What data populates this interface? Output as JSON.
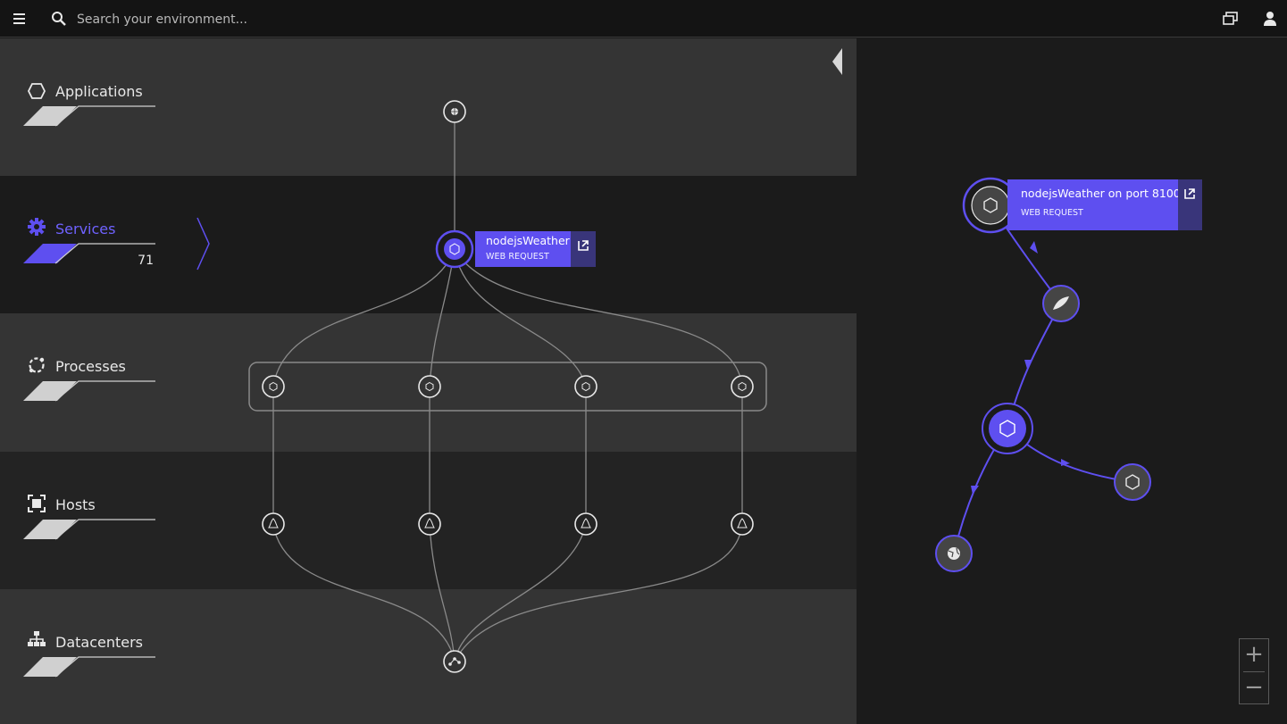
{
  "topbar": {
    "menu_icon": "hamburger-menu-icon",
    "search_icon": "magnifier-search-icon",
    "search_placeholder": "Search your environment...",
    "right_icons": [
      "chat-windows-icon",
      "user-icon"
    ]
  },
  "layers": [
    {
      "label": "Applications",
      "icon": "hexagon-outline-icon",
      "active": false
    },
    {
      "label": "Services",
      "icon": "gear-icon",
      "active": true,
      "count": "71"
    },
    {
      "label": "Processes",
      "icon": "process-chain-icon",
      "active": false
    },
    {
      "label": "Hosts",
      "icon": "host-frame-icon",
      "active": false
    },
    {
      "label": "Datacenters",
      "icon": "org-tree-icon",
      "active": false
    }
  ],
  "graph": {
    "application_node": {
      "icon": "globe-icon"
    },
    "service_node": {
      "title": "nodejsWeather",
      "subtitle": "WEB REQUEST",
      "icon": "nodejs-icon",
      "link_icon": "open-external-icon"
    },
    "process_nodes": [
      {
        "icon": "nodejs-icon"
      },
      {
        "icon": "nodejs-icon"
      },
      {
        "icon": "nodejs-icon"
      },
      {
        "icon": "nodejs-icon"
      }
    ],
    "host_nodes": [
      {
        "icon": "linux-icon"
      },
      {
        "icon": "linux-icon"
      },
      {
        "icon": "linux-icon"
      },
      {
        "icon": "linux-icon"
      }
    ],
    "datacenter_node": {
      "icon": "network-icon"
    }
  },
  "panel_toggle": {
    "icon": "collapse-left-triangle-icon"
  },
  "detail": {
    "card_title": "nodejsWeather on port 8100",
    "card_subtitle": "WEB REQUEST",
    "card_icon": "nodejs-icon",
    "card_link_icon": "open-external-icon",
    "nodes": [
      {
        "icon": "quill-icon"
      },
      {
        "icon": "nodejs-icon"
      },
      {
        "icon": "nodejs-icon"
      },
      {
        "icon": "globe-icon"
      }
    ]
  },
  "zoom": {
    "in_label": "+",
    "out_label": "−"
  },
  "colors": {
    "accent": "#5e4ff0",
    "accent_dark": "#39357a",
    "band_light": "#343434",
    "band_dark": "#1b1b1b",
    "link": "#8a8a8a"
  }
}
